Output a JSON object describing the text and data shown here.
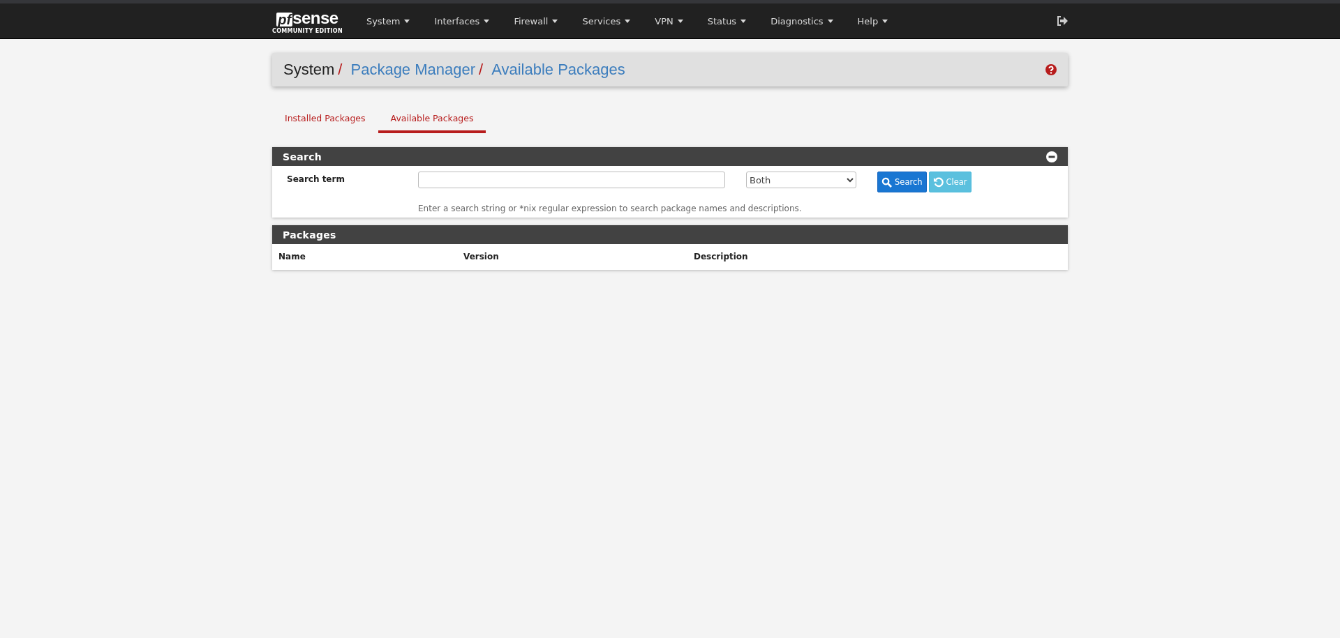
{
  "navbar": {
    "logo": {
      "mark": "pf",
      "word": "sense",
      "edition": "COMMUNITY EDITION"
    },
    "menus": [
      "System",
      "Interfaces",
      "Firewall",
      "Services",
      "VPN",
      "Status",
      "Diagnostics",
      "Help"
    ]
  },
  "breadcrumb": {
    "root": "System",
    "separator": "/",
    "links": [
      "Package Manager",
      "Available Packages"
    ]
  },
  "tabs": [
    {
      "label": "Installed Packages",
      "selected": false
    },
    {
      "label": "Available Packages",
      "selected": true
    }
  ],
  "search_panel": {
    "title": "Search",
    "label": "Search term",
    "scope": "Both",
    "buttons": [
      {
        "label": "Search",
        "kind": "primary"
      },
      {
        "label": "Clear",
        "kind": "info"
      }
    ],
    "help": "Enter a search string or *nix regular expression to search package names and descriptions."
  },
  "packages_panel": {
    "title": "Packages",
    "columns": [
      "Name",
      "Version",
      "Description"
    ]
  }
}
